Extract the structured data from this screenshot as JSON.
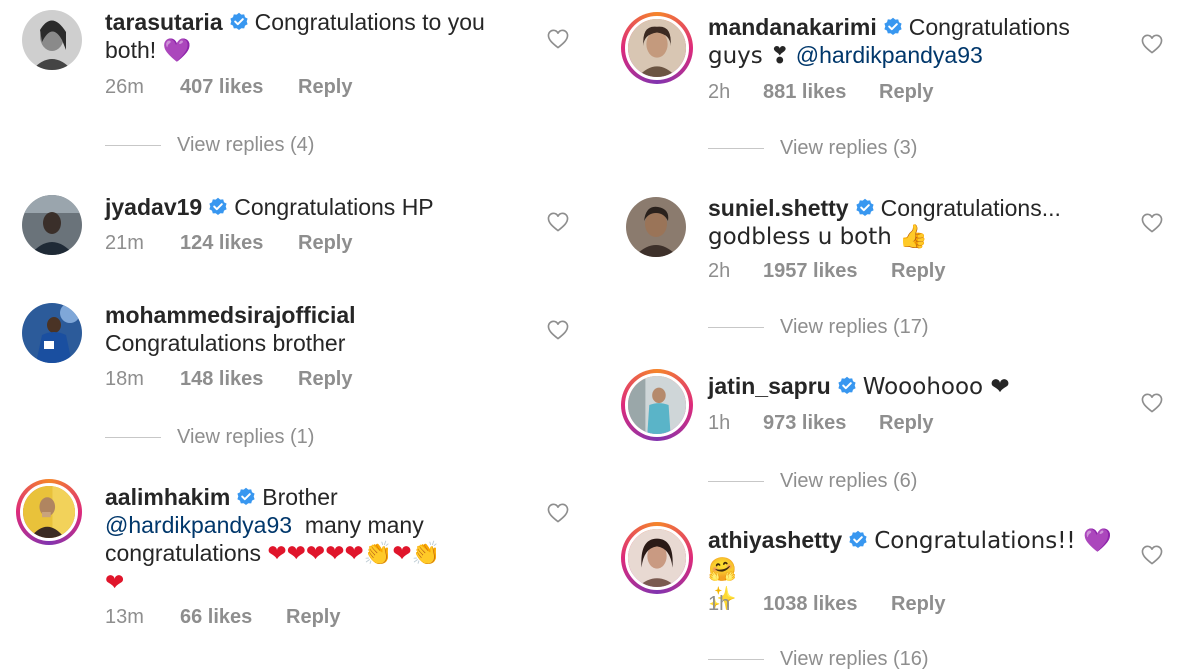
{
  "left": [
    {
      "username": "tarasutaria",
      "text": "Congratulations to you both! 💜",
      "time": "26m",
      "likes": "407 likes",
      "reply": "Reply",
      "view_replies": "View replies (4)"
    },
    {
      "username": "jyadav19",
      "text": "Congratulations HP",
      "time": "21m",
      "likes": "124 likes",
      "reply": "Reply",
      "view_replies": ""
    },
    {
      "username": "mohammedsirajofficial",
      "text": "Congratulations brother",
      "time": "18m",
      "likes": "148 likes",
      "reply": "Reply",
      "view_replies": "View replies (1)"
    },
    {
      "username": "aalimhakim",
      "text_1": "Brother",
      "mention": "@hardikpandya93",
      "text_2": "many many",
      "text_3": "congratulations",
      "emoji_line": "❤❤❤❤❤👏❤👏",
      "emoji_line2": "❤",
      "time": "13m",
      "likes": "66 likes",
      "reply": "Reply"
    }
  ],
  "right": [
    {
      "username": "mandanakarimi",
      "text_1": "Congratulations",
      "text_2": "guys ❣",
      "mention": "@hardikpandya93",
      "time": "2h",
      "likes": "881 likes",
      "reply": "Reply",
      "view_replies": "View replies (3)"
    },
    {
      "username": "suniel.shetty",
      "text_1": "Congratulations...",
      "text_2": "godbless u both 👍",
      "time": "2h",
      "likes": "1957 likes",
      "reply": "Reply",
      "view_replies": "View replies (17)"
    },
    {
      "username": "jatin_sapru",
      "text": "Wooohooo ❤",
      "time": "1h",
      "likes": "973 likes",
      "reply": "Reply",
      "view_replies": "View replies (6)"
    },
    {
      "username": "athiyashetty",
      "text": "Congratulations!! 💜🤗",
      "text_2": "✨",
      "time": "1h",
      "likes": "1038 likes",
      "reply": "Reply",
      "view_replies": "View replies (16)"
    }
  ],
  "colors": {
    "text": "#262626",
    "muted": "#8e8e8e",
    "verified": "#3897f0",
    "mention": "#00376b",
    "heart_red": "#e0152b"
  }
}
